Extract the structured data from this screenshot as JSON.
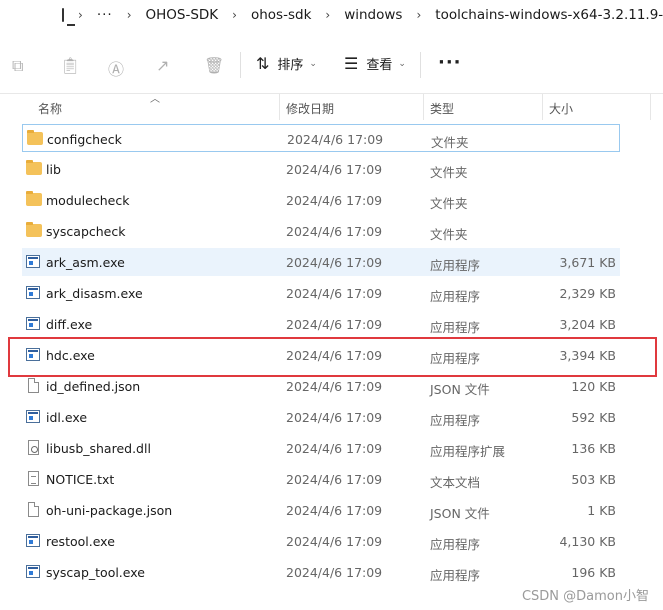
{
  "breadcrumb": {
    "more": "···",
    "items": [
      "OHOS-SDK",
      "ohos-sdk",
      "windows",
      "toolchains-windows-x64-3.2.11.9-"
    ]
  },
  "toolbar": {
    "sort_label": "排序",
    "view_label": "查看",
    "more": "···"
  },
  "columns": {
    "name": "名称",
    "date": "修改日期",
    "type": "类型",
    "size": "大小"
  },
  "files": [
    {
      "name": "configcheck",
      "date": "2024/4/6 17:09",
      "type": "文件夹",
      "size": "",
      "icon": "folder-icon"
    },
    {
      "name": "lib",
      "date": "2024/4/6 17:09",
      "type": "文件夹",
      "size": "",
      "icon": "folder-icon"
    },
    {
      "name": "modulecheck",
      "date": "2024/4/6 17:09",
      "type": "文件夹",
      "size": "",
      "icon": "folder-icon"
    },
    {
      "name": "syscapcheck",
      "date": "2024/4/6 17:09",
      "type": "文件夹",
      "size": "",
      "icon": "folder-icon"
    },
    {
      "name": "ark_asm.exe",
      "date": "2024/4/6 17:09",
      "type": "应用程序",
      "size": "3,671 KB",
      "icon": "exe-icon"
    },
    {
      "name": "ark_disasm.exe",
      "date": "2024/4/6 17:09",
      "type": "应用程序",
      "size": "2,329 KB",
      "icon": "exe-icon"
    },
    {
      "name": "diff.exe",
      "date": "2024/4/6 17:09",
      "type": "应用程序",
      "size": "3,204 KB",
      "icon": "exe-icon"
    },
    {
      "name": "hdc.exe",
      "date": "2024/4/6 17:09",
      "type": "应用程序",
      "size": "3,394 KB",
      "icon": "exe-icon"
    },
    {
      "name": "id_defined.json",
      "date": "2024/4/6 17:09",
      "type": "JSON 文件",
      "size": "120 KB",
      "icon": "json-file-icon"
    },
    {
      "name": "idl.exe",
      "date": "2024/4/6 17:09",
      "type": "应用程序",
      "size": "592 KB",
      "icon": "exe-icon"
    },
    {
      "name": "libusb_shared.dll",
      "date": "2024/4/6 17:09",
      "type": "应用程序扩展",
      "size": "136 KB",
      "icon": "dll-file-icon"
    },
    {
      "name": "NOTICE.txt",
      "date": "2024/4/6 17:09",
      "type": "文本文档",
      "size": "503 KB",
      "icon": "text-file-icon"
    },
    {
      "name": "oh-uni-package.json",
      "date": "2024/4/6 17:09",
      "type": "JSON 文件",
      "size": "1 KB",
      "icon": "json-file-icon"
    },
    {
      "name": "restool.exe",
      "date": "2024/4/6 17:09",
      "type": "应用程序",
      "size": "4,130 KB",
      "icon": "exe-icon"
    },
    {
      "name": "syscap_tool.exe",
      "date": "2024/4/6 17:09",
      "type": "应用程序",
      "size": "196 KB",
      "icon": "exe-icon"
    }
  ],
  "watermark": "CSDN @Damon小智",
  "colors": {
    "highlight": "#e0393e",
    "selection": "#eaf3fc",
    "folder": "#f4c25a"
  }
}
